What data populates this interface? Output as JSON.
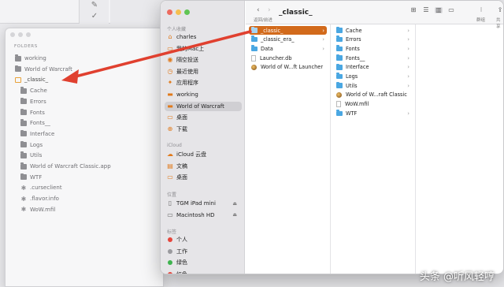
{
  "editor": {
    "folders_header": "FOLDERS",
    "tree": [
      {
        "label": "working",
        "icon": "folder-icon",
        "indent": 0
      },
      {
        "label": "World of Warcraft",
        "icon": "folder-icon",
        "indent": 0
      },
      {
        "label": "_classic_",
        "icon": "folder-open-icon",
        "indent": 0,
        "selected": true
      },
      {
        "label": "Cache",
        "icon": "folder-icon",
        "indent": 1
      },
      {
        "label": "Errors",
        "icon": "folder-icon",
        "indent": 1
      },
      {
        "label": "Fonts",
        "icon": "folder-icon",
        "indent": 1
      },
      {
        "label": "Fonts__",
        "icon": "folder-icon",
        "indent": 1
      },
      {
        "label": "Interface",
        "icon": "folder-icon",
        "indent": 1
      },
      {
        "label": "Logs",
        "icon": "folder-icon",
        "indent": 1
      },
      {
        "label": "Utils",
        "icon": "folder-icon",
        "indent": 1
      },
      {
        "label": "World of Warcraft Classic.app",
        "icon": "folder-icon",
        "indent": 1
      },
      {
        "label": "WTF",
        "icon": "folder-icon",
        "indent": 1
      },
      {
        "label": ".curseclient",
        "icon": "asterisk-icon",
        "indent": 1
      },
      {
        "label": ".flavor.info",
        "icon": "asterisk-icon",
        "indent": 1
      },
      {
        "label": "WoW.mfil",
        "icon": "asterisk-icon",
        "indent": 1
      }
    ]
  },
  "finder": {
    "title": "_classic_",
    "nav_caption": "返回/前进",
    "toolbar_right_captions": [
      "群组",
      "共享"
    ],
    "sidebar": {
      "favorites_header": "个人收藏",
      "favorites": [
        {
          "label": "charles",
          "icon": "home-icon"
        },
        {
          "label": "我的Mac上",
          "icon": "desktop-icon"
        },
        {
          "label": "隔空投送",
          "icon": "airdrop-icon"
        },
        {
          "label": "最近使用",
          "icon": "clock-icon"
        },
        {
          "label": "应用程序",
          "icon": "apps-icon"
        },
        {
          "label": "working",
          "icon": "folder-icon"
        },
        {
          "label": "World of Warcraft",
          "icon": "folder-icon",
          "active": true
        },
        {
          "label": "桌面",
          "icon": "desktop-icon"
        },
        {
          "label": "下载",
          "icon": "download-icon"
        }
      ],
      "icloud_header": "iCloud",
      "icloud": [
        {
          "label": "iCloud 云盘",
          "icon": "cloud-icon"
        },
        {
          "label": "文稿",
          "icon": "document-icon"
        },
        {
          "label": "桌面",
          "icon": "desktop-icon"
        }
      ],
      "locations_header": "位置",
      "locations": [
        {
          "label": "TGM iPad mini",
          "icon": "ipad-icon"
        },
        {
          "label": "Macintosh HD",
          "icon": "disk-icon"
        }
      ],
      "tags_header": "标签",
      "tags": [
        {
          "label": "个人",
          "color": "#e5453b"
        },
        {
          "label": "工作",
          "color": "#9a9a9e"
        },
        {
          "label": "绿色",
          "color": "#3fb34f"
        },
        {
          "label": "红色",
          "color": "#e5453b"
        }
      ]
    },
    "column1": [
      {
        "label": "_classic_",
        "icon": "folder-icon",
        "chevron": true,
        "selected": true
      },
      {
        "label": "_classic_era_",
        "icon": "folder-icon",
        "chevron": true
      },
      {
        "label": "Data",
        "icon": "folder-icon",
        "chevron": true
      },
      {
        "label": "Launcher.db",
        "icon": "file-icon"
      },
      {
        "label": "World of W...ft Launcher",
        "icon": "app-icon"
      }
    ],
    "column2": [
      {
        "label": "Cache",
        "icon": "folder-icon",
        "chevron": true
      },
      {
        "label": "Errors",
        "icon": "folder-icon",
        "chevron": true
      },
      {
        "label": "Fonts",
        "icon": "folder-icon",
        "chevron": true
      },
      {
        "label": "Fonts__",
        "icon": "folder-icon",
        "chevron": true
      },
      {
        "label": "Interface",
        "icon": "folder-icon",
        "chevron": true
      },
      {
        "label": "Logs",
        "icon": "folder-icon",
        "chevron": true
      },
      {
        "label": "Utils",
        "icon": "folder-icon",
        "chevron": true
      },
      {
        "label": "World of W...raft Classic",
        "icon": "app-icon"
      },
      {
        "label": "WoW.mfil",
        "icon": "file-icon"
      },
      {
        "label": "WTF",
        "icon": "folder-icon",
        "chevron": true
      }
    ]
  },
  "watermark": "头条 @听风轻哼",
  "colors": {
    "accent": "#d26a1b",
    "arrow": "#e0402f",
    "folder_blue": "#4aa7e2"
  }
}
